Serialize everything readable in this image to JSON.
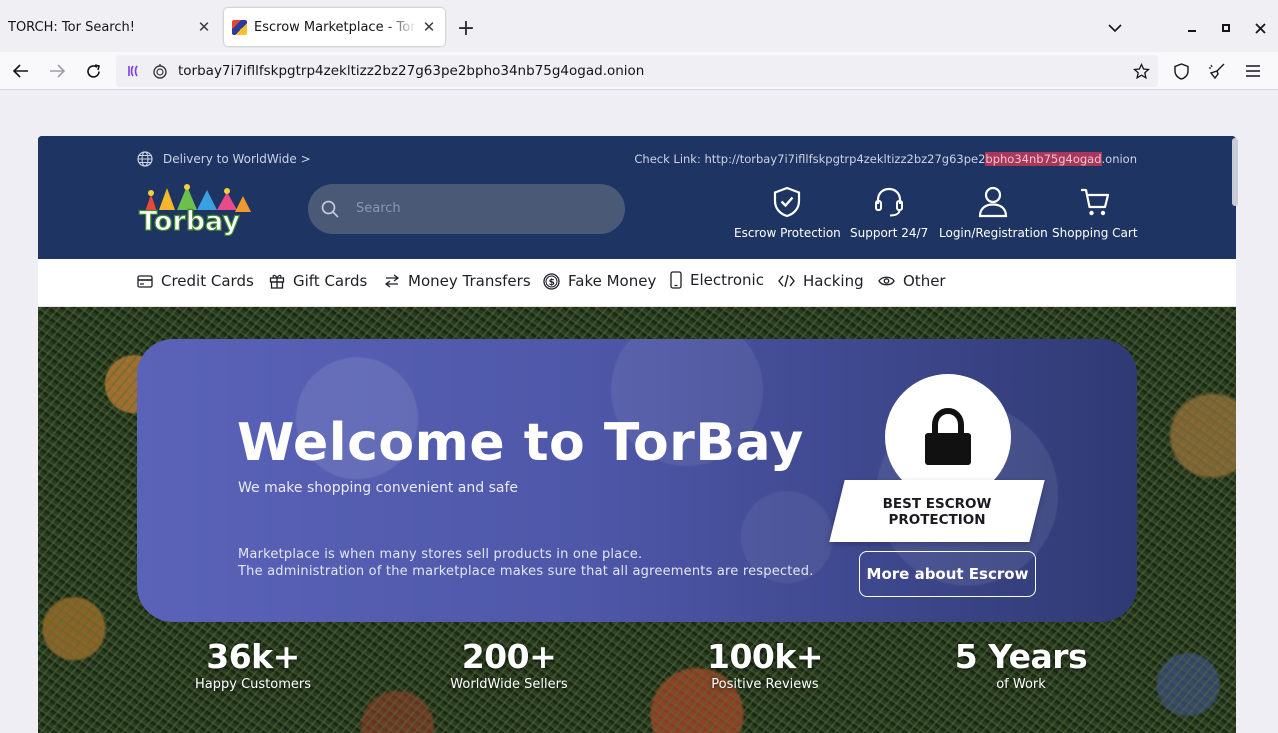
{
  "browser": {
    "tabs": [
      {
        "title": "TORCH: Tor Search!",
        "active": false
      },
      {
        "title": "Escrow Marketplace - TorBay",
        "active": true
      }
    ],
    "url": "torbay7i7ifllfskpgtrp4zekltizz2bz27g63pe2bpho34nb75g4ogad.onion"
  },
  "header": {
    "delivery": "Delivery to WorldWide >",
    "check_link_prefix": "Check Link: http://torbay7i7ifllfskpgtrp4zekltizz2bz27g63pe2",
    "check_link_highlight": "bpho34nb75g4ogad",
    "check_link_suffix": ".onion",
    "search_placeholder": "Search",
    "actions": [
      {
        "label": "Escrow Protection",
        "icon": "shield-check-icon"
      },
      {
        "label": "Support 24/7",
        "icon": "headset-icon"
      },
      {
        "label": "Login/Registration",
        "icon": "user-icon"
      },
      {
        "label": "Shopping Cart",
        "icon": "cart-icon"
      }
    ]
  },
  "categories": [
    {
      "label": "Credit Cards",
      "icon": "credit-card-icon"
    },
    {
      "label": "Gift Cards",
      "icon": "gift-icon"
    },
    {
      "label": "Money Transfers",
      "icon": "transfer-icon"
    },
    {
      "label": "Fake Money",
      "icon": "coin-icon"
    },
    {
      "label": "Electronic",
      "icon": "phone-icon"
    },
    {
      "label": "Hacking",
      "icon": "code-icon"
    },
    {
      "label": "Other",
      "icon": "eye-icon"
    }
  ],
  "hero": {
    "title": "Welcome to TorBay",
    "subtitle": "We make shopping convenient and safe",
    "paragraph_1": "Marketplace is when many stores sell products in one place.",
    "paragraph_2": "The administration of the marketplace makes sure that all agreements are respected.",
    "badge_line_1": "BEST ESCROW",
    "badge_line_2": "PROTECTION",
    "more_button": "More about Escrow"
  },
  "stats": [
    {
      "value": "36k+",
      "label": "Happy Customers"
    },
    {
      "value": "200+",
      "label": "WorldWide Sellers"
    },
    {
      "value": "100k+",
      "label": "Positive Reviews"
    },
    {
      "value": "5 Years",
      "label": "of Work"
    }
  ],
  "logo_text": "Torbay",
  "colors": {
    "header_bg": "#1e3462",
    "banner_start": "#5a63b8",
    "banner_end": "#2f3a74",
    "highlight": "#a8375a"
  }
}
